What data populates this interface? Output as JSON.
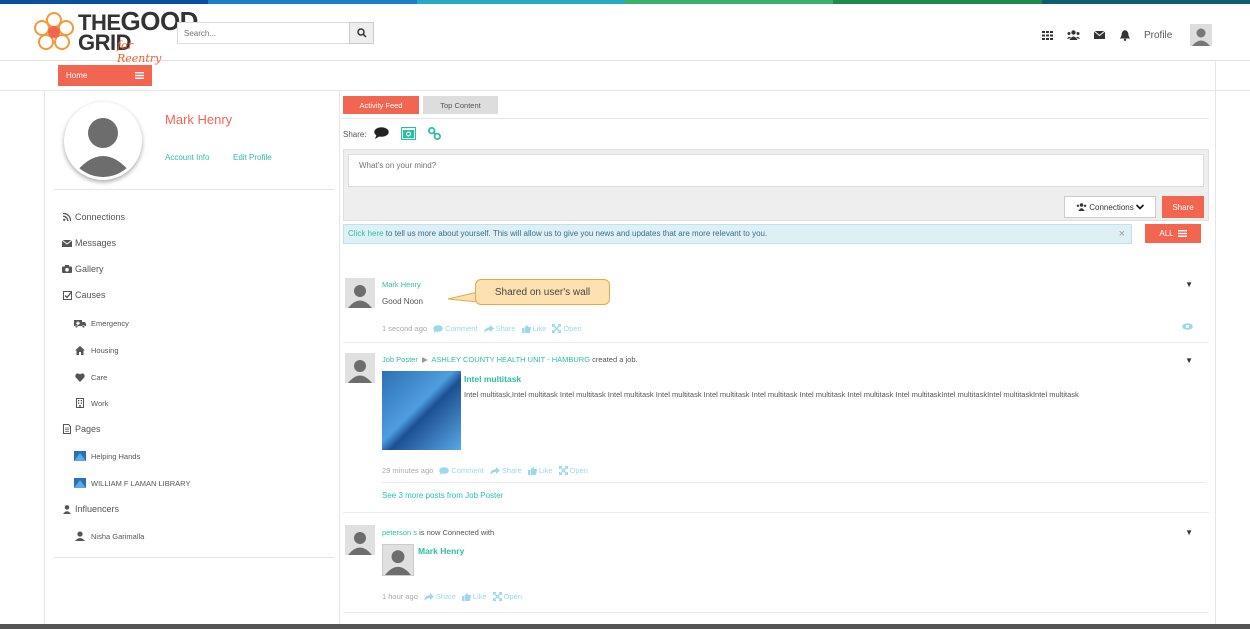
{
  "brand": {
    "logo_main": "THE GOOD GRID",
    "logo_sub": "for Reentry",
    "stripe_colors": [
      "#0d4f9c",
      "#1a7fc9",
      "#25a9c4",
      "#3ab26e",
      "#1e8a4b",
      "#0e5e6f"
    ]
  },
  "header": {
    "search_placeholder": "Search...",
    "profile_label": "Profile",
    "icons": [
      "apps-grid-icon",
      "users-icon",
      "envelope-icon",
      "bell-icon"
    ]
  },
  "subnav": {
    "home_label": "Home"
  },
  "sidebar": {
    "user_name": "Mark Henry",
    "account_info": "Account Info",
    "edit_profile": "Edit Profile",
    "items": [
      {
        "label": "Connections",
        "icon": "rss-icon"
      },
      {
        "label": "Messages",
        "icon": "envelope-icon"
      },
      {
        "label": "Gallery",
        "icon": "camera-icon"
      },
      {
        "label": "Causes",
        "icon": "checkbox-icon"
      },
      {
        "label": "Emergency",
        "icon": "ambulance-icon"
      },
      {
        "label": "Housing",
        "icon": "home-icon"
      },
      {
        "label": "Care",
        "icon": "heart-icon"
      },
      {
        "label": "Work",
        "icon": "building-icon"
      },
      {
        "label": "Pages",
        "icon": "file-icon"
      },
      {
        "label": "Helping Hands",
        "icon": "page-thumb"
      },
      {
        "label": "WILLIAM F LAMAN LIBRARY",
        "icon": "page-thumb"
      },
      {
        "label": "Influencers",
        "icon": "user-icon"
      },
      {
        "label": "Nisha Garimalla",
        "icon": "user-icon"
      }
    ]
  },
  "main": {
    "tabs": [
      {
        "label": "Activity Feed",
        "active": true
      },
      {
        "label": "Top Content",
        "active": false
      }
    ],
    "share_label": "Share:",
    "composer_placeholder": "What's on your mind?",
    "connections_btn": "Connections",
    "share_btn": "Share",
    "info_link": "Click here",
    "info_text": " to tell us more about yourself. This will allow us to give you news and updates that are more relevant to you.",
    "info_close": "×",
    "all_btn": "ALL",
    "callout": "Shared on user's wall",
    "posts": [
      {
        "author": "Mark Henry",
        "body": "Good Noon",
        "time": "1 second ago",
        "actions": [
          "Comment",
          "Share",
          "Like",
          "Open"
        ]
      },
      {
        "author": "Job Poster",
        "target": "ASHLEY COUNTY HEALTH UNIT - HAMBURG",
        "verb": " created a job.",
        "job_title": "Intel multitask",
        "job_desc": "Intel multitask,Intel multitask Intel multitask Intel multitask Intel multitask Intel multitask Intel multitask Intel multitask Intel multitask  Intel multitaskIntel multitaskIntel multitaskIntel multitask",
        "time": "29 minutes ago",
        "actions": [
          "Comment",
          "Share",
          "Like",
          "Open"
        ],
        "see_more": "See 3 more posts from Job Poster"
      },
      {
        "author": "peterson s",
        "verb": " is now Connected with",
        "connected_name": "Mark Henry",
        "time": "1 hour ago",
        "actions": [
          "Share",
          "Like",
          "Open"
        ]
      }
    ]
  }
}
